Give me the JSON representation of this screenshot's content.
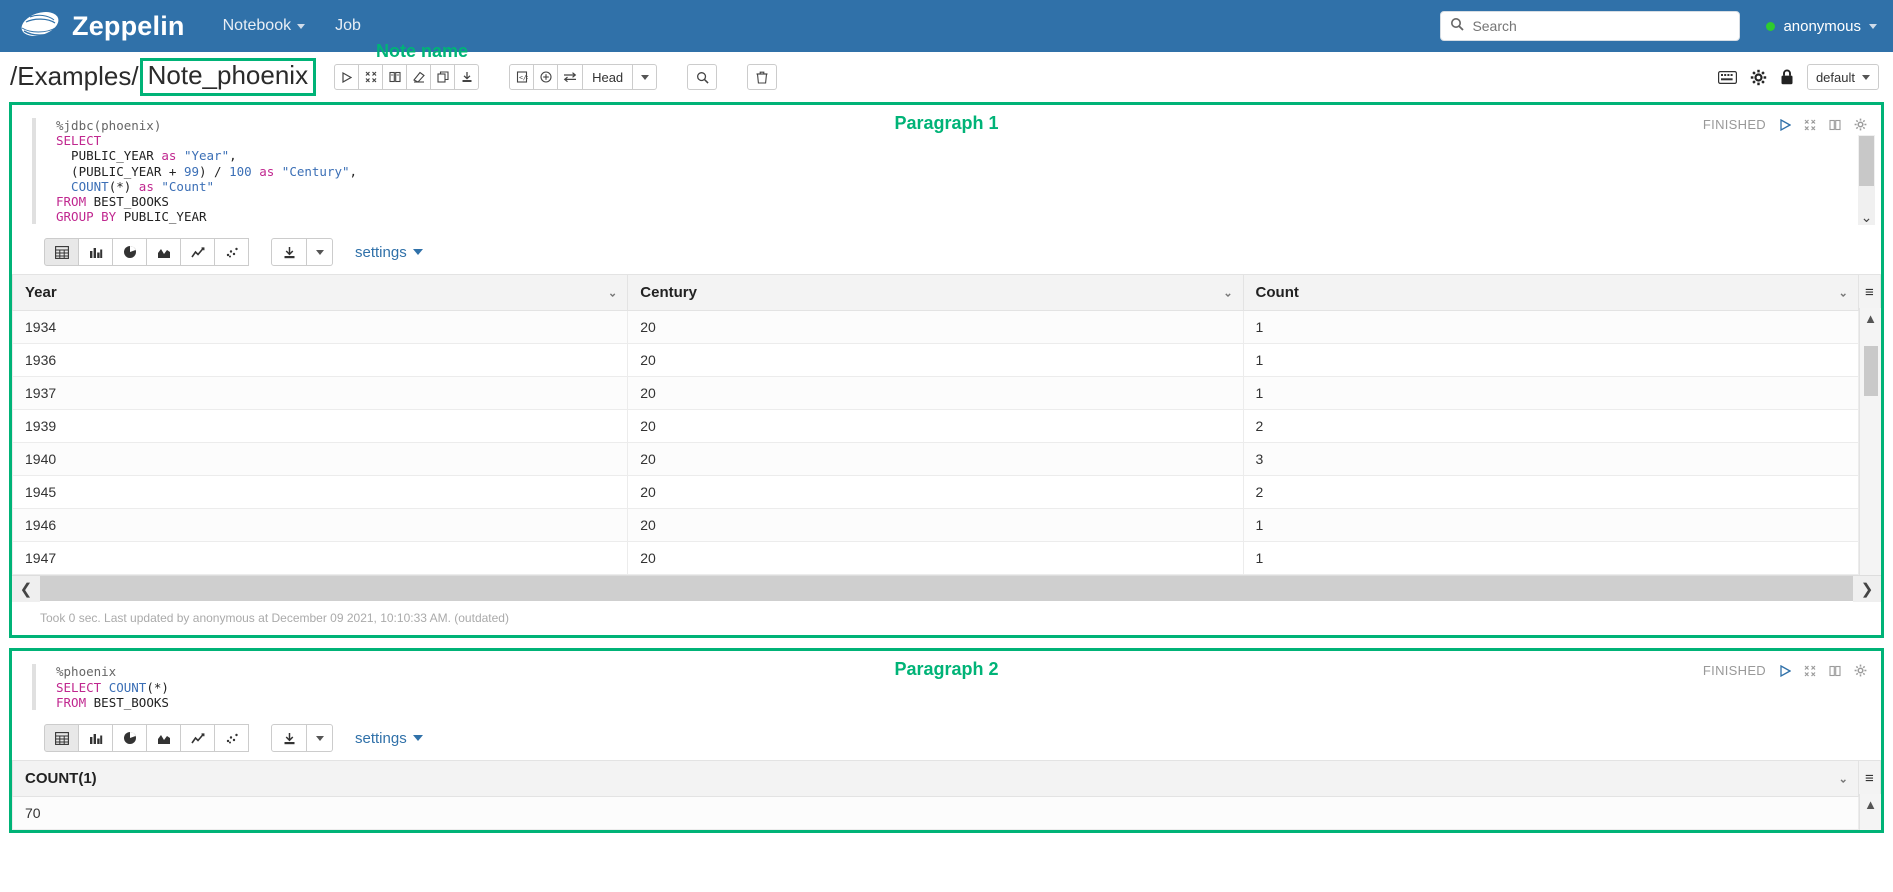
{
  "navbar": {
    "brand": "Zeppelin",
    "links": [
      {
        "label": "Notebook",
        "has_caret": true
      },
      {
        "label": "Job",
        "has_caret": false
      }
    ],
    "search": {
      "placeholder": "Search",
      "value": ""
    },
    "user": {
      "name": "anonymous",
      "status_color": "#2ecc2e"
    },
    "bg_color": "#3071a9"
  },
  "note_header": {
    "path_prefix": "/Examples/",
    "note_name": "Note_phoenix",
    "annotation_note_name": "Note name",
    "annotation_color": "#00b377",
    "action_buttons": [
      {
        "name": "run-all-paragraphs",
        "glyph": "▷"
      },
      {
        "name": "hide-show-all-code",
        "glyph": "⤡"
      },
      {
        "name": "hide-show-all-output",
        "glyph": "▤"
      },
      {
        "name": "clear-all-output",
        "glyph": "◣"
      },
      {
        "name": "clone-note",
        "glyph": "⧉"
      },
      {
        "name": "export-note",
        "glyph": "⤓"
      }
    ],
    "mode_buttons": [
      {
        "name": "show-code-mode",
        "glyph": "⌸"
      },
      {
        "name": "add-permission",
        "glyph": "⊕"
      },
      {
        "name": "toggle-shortcuts",
        "glyph": "⇄"
      }
    ],
    "head_label": "Head",
    "right_icons": [
      {
        "name": "keyboard-shortcuts-icon",
        "glyph": "⌨"
      },
      {
        "name": "gear-icon",
        "glyph": "⚙"
      },
      {
        "name": "lock-icon",
        "glyph": "🔒"
      }
    ],
    "interpreter_binding": "default"
  },
  "paragraphs": [
    {
      "annotation": "Paragraph 1",
      "status": "FINISHED",
      "code_lines": [
        [
          {
            "t": "%jdbc(phoenix)",
            "c": "k-pct"
          }
        ],
        [
          {
            "t": "SELECT",
            "c": "k-kw"
          }
        ],
        [
          {
            "t": "  PUBLIC_YEAR ",
            "c": ""
          },
          {
            "t": "as ",
            "c": "k-as"
          },
          {
            "t": "\"Year\"",
            "c": "k-str"
          },
          {
            "t": ",",
            "c": ""
          }
        ],
        [
          {
            "t": "  (PUBLIC_YEAR + ",
            "c": ""
          },
          {
            "t": "99",
            "c": "k-num"
          },
          {
            "t": ") / ",
            "c": ""
          },
          {
            "t": "100 ",
            "c": "k-num"
          },
          {
            "t": "as ",
            "c": "k-as"
          },
          {
            "t": "\"Century\"",
            "c": "k-str"
          },
          {
            "t": ",",
            "c": ""
          }
        ],
        [
          {
            "t": "  COUNT",
            "c": "k-fn"
          },
          {
            "t": "(*) ",
            "c": ""
          },
          {
            "t": "as ",
            "c": "k-as"
          },
          {
            "t": "\"Count\"",
            "c": "k-str"
          }
        ],
        [
          {
            "t": "FROM ",
            "c": "k-kw"
          },
          {
            "t": "BEST_BOOKS",
            "c": ""
          }
        ],
        [
          {
            "t": "GROUP BY ",
            "c": "k-kw"
          },
          {
            "t": "PUBLIC_YEAR",
            "c": ""
          }
        ]
      ],
      "viz_buttons": [
        {
          "name": "table-viz-button",
          "glyph": "▦",
          "active": true
        },
        {
          "name": "bar-chart-viz-button",
          "glyph": "▥",
          "active": false
        },
        {
          "name": "pie-chart-viz-button",
          "glyph": "◕",
          "active": false
        },
        {
          "name": "area-chart-viz-button",
          "glyph": "◭",
          "active": false
        },
        {
          "name": "line-chart-viz-button",
          "glyph": "📈",
          "active": false
        },
        {
          "name": "scatter-chart-viz-button",
          "glyph": "⁘",
          "active": false
        }
      ],
      "download_label": "⤓",
      "settings_label": "settings",
      "table": {
        "columns": [
          "Year",
          "Century",
          "Count"
        ],
        "rows": [
          [
            "1934",
            "20",
            "1"
          ],
          [
            "1936",
            "20",
            "1"
          ],
          [
            "1937",
            "20",
            "1"
          ],
          [
            "1939",
            "20",
            "2"
          ],
          [
            "1940",
            "20",
            "3"
          ],
          [
            "1945",
            "20",
            "2"
          ],
          [
            "1946",
            "20",
            "1"
          ],
          [
            "1947",
            "20",
            "1"
          ]
        ]
      },
      "footer": "Took 0 sec. Last updated by anonymous at December 09 2021, 10:10:33 AM. (outdated)"
    },
    {
      "annotation": "Paragraph 2",
      "status": "FINISHED",
      "code_lines": [
        [
          {
            "t": "%phoenix",
            "c": "k-pct"
          }
        ],
        [
          {
            "t": "SELECT ",
            "c": "k-kw"
          },
          {
            "t": "COUNT",
            "c": "k-fn"
          },
          {
            "t": "(*)",
            "c": ""
          }
        ],
        [
          {
            "t": "FROM ",
            "c": "k-kw"
          },
          {
            "t": "BEST_BOOKS",
            "c": ""
          }
        ]
      ],
      "viz_buttons": [
        {
          "name": "table-viz-button",
          "glyph": "▦",
          "active": true
        },
        {
          "name": "bar-chart-viz-button",
          "glyph": "▥",
          "active": false
        },
        {
          "name": "pie-chart-viz-button",
          "glyph": "◕",
          "active": false
        },
        {
          "name": "area-chart-viz-button",
          "glyph": "◭",
          "active": false
        },
        {
          "name": "line-chart-viz-button",
          "glyph": "📈",
          "active": false
        },
        {
          "name": "scatter-chart-viz-button",
          "glyph": "⁘",
          "active": false
        }
      ],
      "download_label": "⤓",
      "settings_label": "settings",
      "table": {
        "columns": [
          "COUNT(1)"
        ],
        "rows": [
          [
            "70"
          ]
        ]
      }
    }
  ]
}
